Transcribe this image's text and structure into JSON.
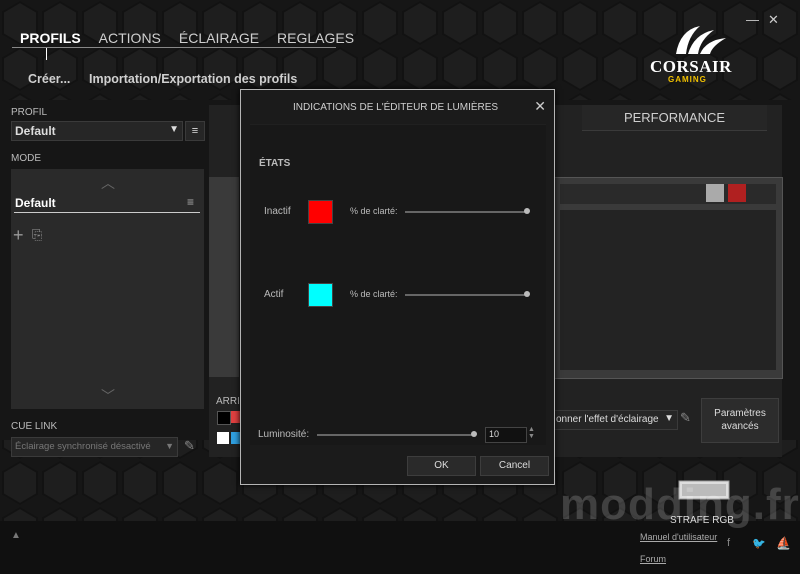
{
  "app": {
    "window_controls": {
      "minimize": "—",
      "close": "✕"
    },
    "logo": {
      "brand": "CORSAIR",
      "sub": "GAMING"
    }
  },
  "nav": {
    "tabs": [
      "PROFILS",
      "ACTIONS",
      "ÉCLAIRAGE",
      "REGLAGES"
    ],
    "active": "PROFILS"
  },
  "subnav": {
    "create": "Créer...",
    "import_export": "Importation/Exportation des profils"
  },
  "left": {
    "profile_label": "PROFIL",
    "profile_value": "Default",
    "mode_label": "MODE",
    "mode_item": "Default",
    "cue_link_label": "CUE LINK",
    "cue_link_value": "Éclairage synchronisé désactivé"
  },
  "main": {
    "performance_tab": "PERFORMANCE",
    "arriere_label": "ARRIÈ",
    "effect_select": "onner l'effet d'éclairage",
    "advanced_button": "Paramètres\navancés"
  },
  "modal": {
    "title": "INDICATIONS DE L'ÉDITEUR DE LUMIÈRES",
    "section": "ÉTATS",
    "states": [
      {
        "label": "Inactif",
        "color": "#ff0000",
        "brightness_label": "% de clarté:",
        "brightness": 1.0
      },
      {
        "label": "Actif",
        "color": "#00ffff",
        "brightness_label": "% de clarté:",
        "brightness": 1.0
      }
    ],
    "luminosity_label": "Luminosité:",
    "luminosity_value": "10",
    "ok": "OK",
    "cancel": "Cancel"
  },
  "footer": {
    "device": "STRAFE RGB",
    "manual": "Manuel d'utilisateur",
    "forum": "Forum",
    "watermark": "modding.fr"
  }
}
